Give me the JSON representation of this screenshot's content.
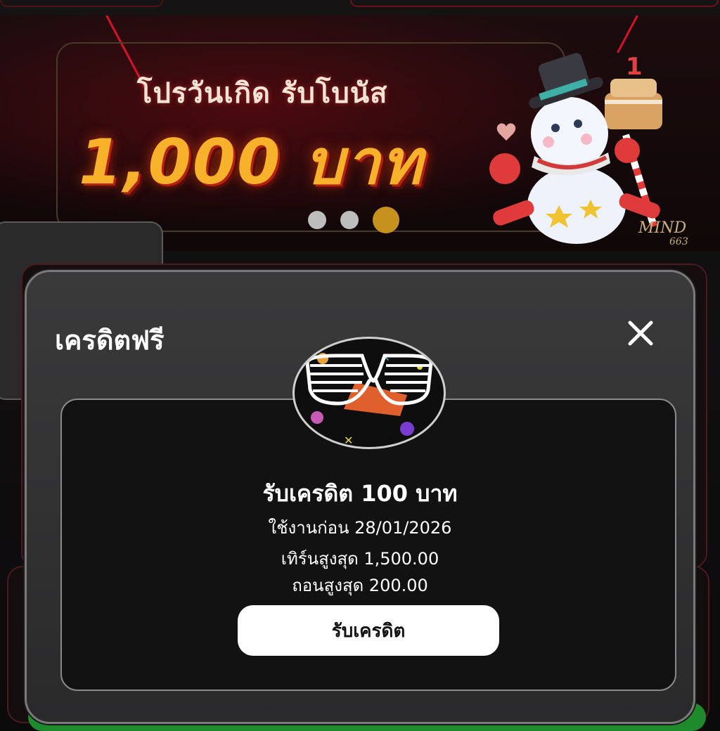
{
  "banner": {
    "title": "โปรวันเกิด รับโบนัส",
    "amount": "1,000 บาท",
    "carousel_dots": 3,
    "active_dot": 3,
    "brand_logo": "MIND",
    "brand_number": "663",
    "accent_color": "#f7b12a"
  },
  "modal": {
    "title": "เครดิตฟรี",
    "close_icon": "close-icon",
    "offer": {
      "title": "รับเครดิต 100 บาท",
      "expiry": "ใช้งานก่อน 28/01/2026",
      "max_turnover": "เทิร์นสูงสุด 1,500.00",
      "max_withdraw": "ถอนสูงสุด 200.00"
    },
    "claim_button_label": "รับเครดิต"
  }
}
